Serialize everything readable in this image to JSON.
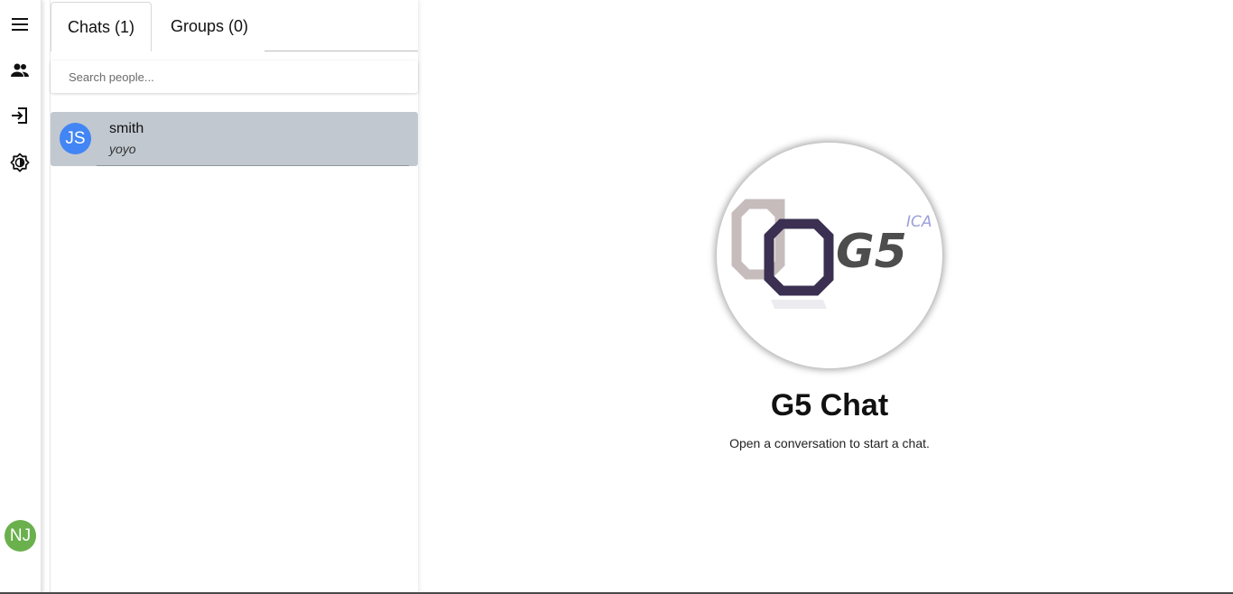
{
  "rail": {
    "icons": [
      "menu-icon",
      "people-icon",
      "logout-icon",
      "brightness-icon"
    ],
    "user_initials": "NJ",
    "user_avatar_color": "#6ab04c"
  },
  "tabs": [
    {
      "label": "Chats (1)",
      "active": true
    },
    {
      "label": "Groups (0)",
      "active": false
    }
  ],
  "search": {
    "placeholder": "Search people..."
  },
  "chats": [
    {
      "initials": "JS",
      "name": "smith",
      "last_message": "yoyo",
      "avatar_color": "#4285f4",
      "selected": true
    }
  ],
  "main": {
    "logo_text": "G5",
    "logo_badge": "ICA",
    "title": "G5 Chat",
    "subtitle": "Open a conversation to start a chat."
  },
  "colors": {
    "selected_row": "#c1c8d0",
    "logo_dark": "#3b3052",
    "logo_light": "#c7bcbc",
    "logo_badge": "#9aa0d8"
  }
}
